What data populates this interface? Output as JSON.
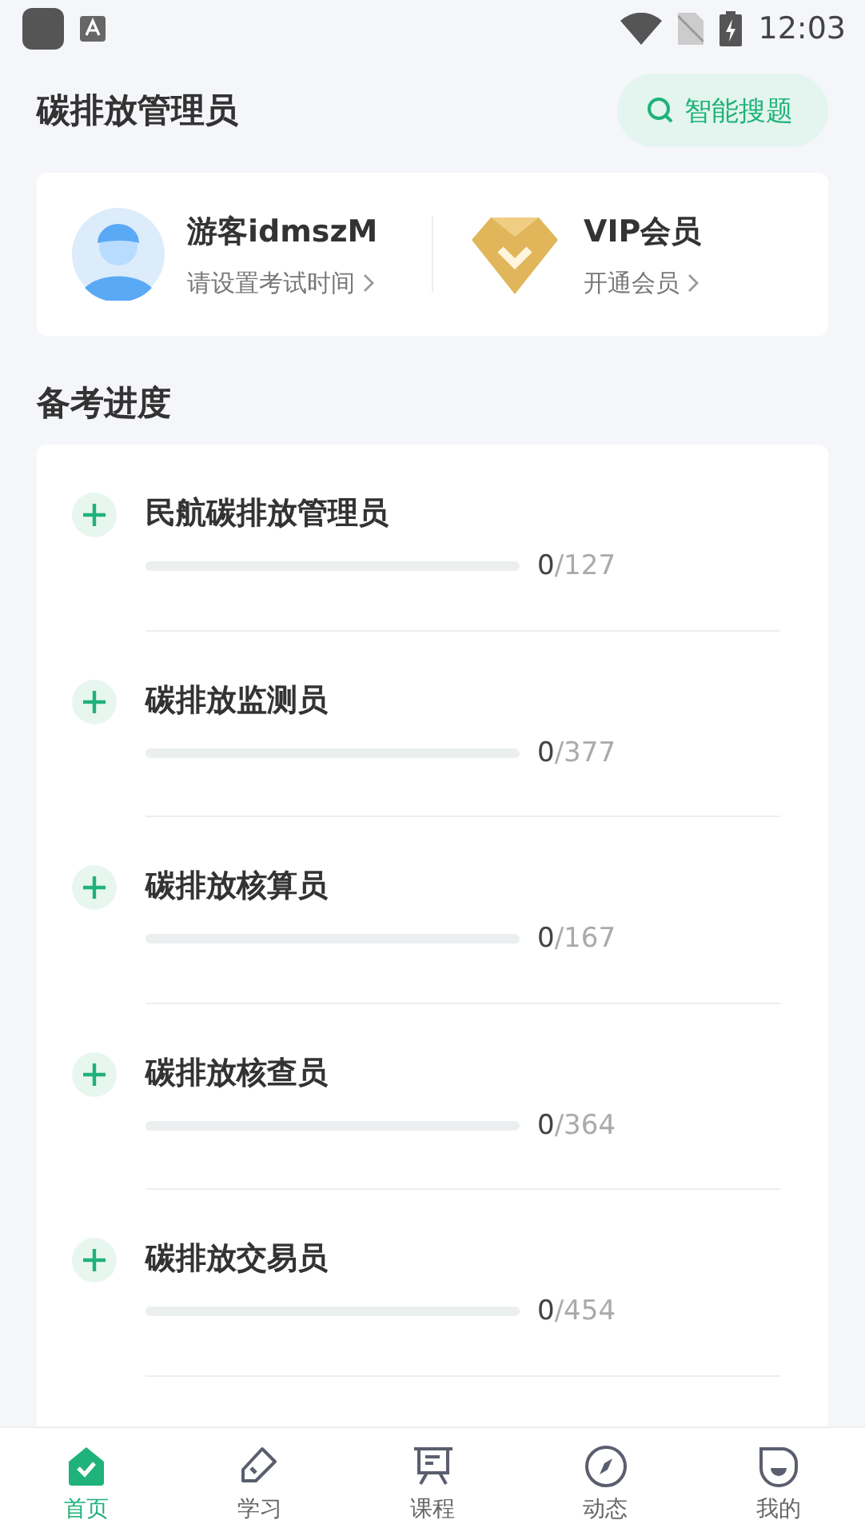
{
  "status_bar": {
    "time": "12:03"
  },
  "header": {
    "title": "碳排放管理员",
    "search_button": "智能搜题"
  },
  "user_card": {
    "name": "游客idmszM",
    "subtitle": "请设置考试时间",
    "vip_title": "VIP会员",
    "vip_subtitle": "开通会员"
  },
  "section_title": "备考进度",
  "progress_items": [
    {
      "title": "民航碳排放管理员",
      "level": 0,
      "done": "0",
      "total": "/127"
    },
    {
      "title": "碳排放监测员",
      "level": 0,
      "done": "0",
      "total": "/377"
    },
    {
      "title": "碳排放核算员",
      "level": 0,
      "done": "0",
      "total": "/167"
    },
    {
      "title": "碳排放核查员",
      "level": 0,
      "done": "0",
      "total": "/364"
    },
    {
      "title": "碳排放交易员",
      "level": 0,
      "done": "0",
      "total": "/454"
    }
  ],
  "tabs": [
    {
      "label": "首页",
      "kind": "home",
      "selected": true
    },
    {
      "label": "学习",
      "kind": "study",
      "selected": false
    },
    {
      "label": "课程",
      "kind": "course",
      "selected": false
    },
    {
      "label": "动态",
      "kind": "compass",
      "selected": false
    },
    {
      "label": "我的",
      "kind": "me",
      "selected": false
    }
  ]
}
